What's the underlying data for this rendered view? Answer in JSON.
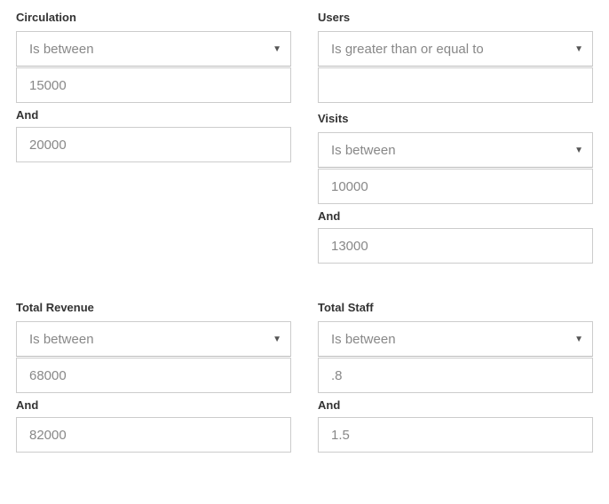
{
  "andLabel": "And",
  "filters": {
    "circulation": {
      "label": "Circulation",
      "operator": "Is between",
      "value1": "15000",
      "value2": "20000"
    },
    "users": {
      "label": "Users",
      "operator": "Is greater than or equal to",
      "value1": ""
    },
    "visits": {
      "label": "Visits",
      "operator": "Is between",
      "value1": "10000",
      "value2": "13000"
    },
    "totalRevenue": {
      "label": "Total Revenue",
      "operator": "Is between",
      "value1": "68000",
      "value2": "82000"
    },
    "totalStaff": {
      "label": "Total Staff",
      "operator": "Is between",
      "value1": ".8",
      "value2": "1.5"
    }
  }
}
